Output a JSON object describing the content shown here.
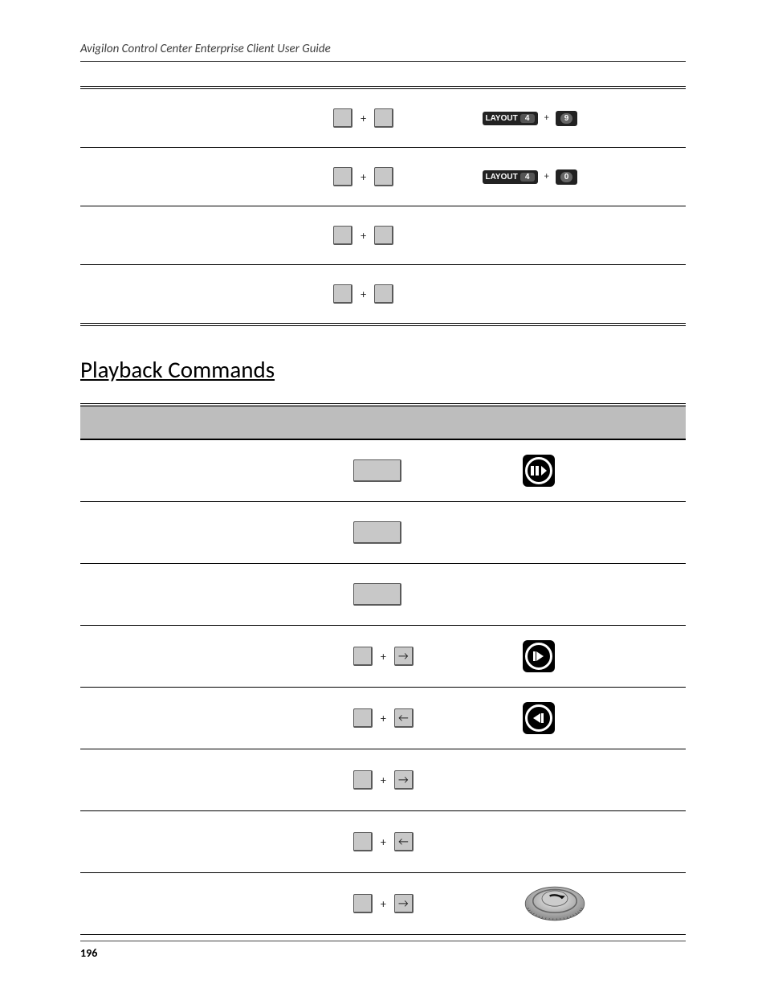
{
  "header": {
    "title": "Avigilon Control Center Enterprise Client User Guide"
  },
  "footer": {
    "page_number": "196"
  },
  "table1": {
    "rows": [
      {
        "keys": [
          {
            "shape": "small"
          },
          {
            "shape": "small"
          }
        ],
        "joystick": {
          "layout_label": "LAYOUT",
          "layout_num": "4",
          "key_num": "9"
        }
      },
      {
        "keys": [
          {
            "shape": "small"
          },
          {
            "shape": "small"
          }
        ],
        "joystick": {
          "layout_label": "LAYOUT",
          "layout_num": "4",
          "key_num": "0"
        }
      },
      {
        "keys": [
          {
            "shape": "small"
          },
          {
            "shape": "small"
          }
        ],
        "joystick": null
      },
      {
        "keys": [
          {
            "shape": "small"
          },
          {
            "shape": "small"
          }
        ],
        "joystick": null
      }
    ]
  },
  "section": {
    "title": "Playback Commands"
  },
  "table2": {
    "rows": [
      {
        "keys": [
          {
            "shape": "wide"
          }
        ],
        "icon": "pause-play"
      },
      {
        "keys": [
          {
            "shape": "wide"
          }
        ],
        "icon": null
      },
      {
        "keys": [
          {
            "shape": "wide"
          }
        ],
        "icon": null
      },
      {
        "keys": [
          {
            "shape": "small"
          },
          {
            "shape": "small",
            "glyph": "→"
          }
        ],
        "icon": "step-forward"
      },
      {
        "keys": [
          {
            "shape": "small"
          },
          {
            "shape": "small",
            "glyph": "←"
          }
        ],
        "icon": "step-backward"
      },
      {
        "keys": [
          {
            "shape": "small"
          },
          {
            "shape": "small",
            "glyph": "→"
          }
        ],
        "icon": null
      },
      {
        "keys": [
          {
            "shape": "small"
          },
          {
            "shape": "small",
            "glyph": "←"
          }
        ],
        "icon": null
      },
      {
        "keys": [
          {
            "shape": "small"
          },
          {
            "shape": "small",
            "glyph": "→"
          }
        ],
        "icon": "jog"
      }
    ]
  }
}
